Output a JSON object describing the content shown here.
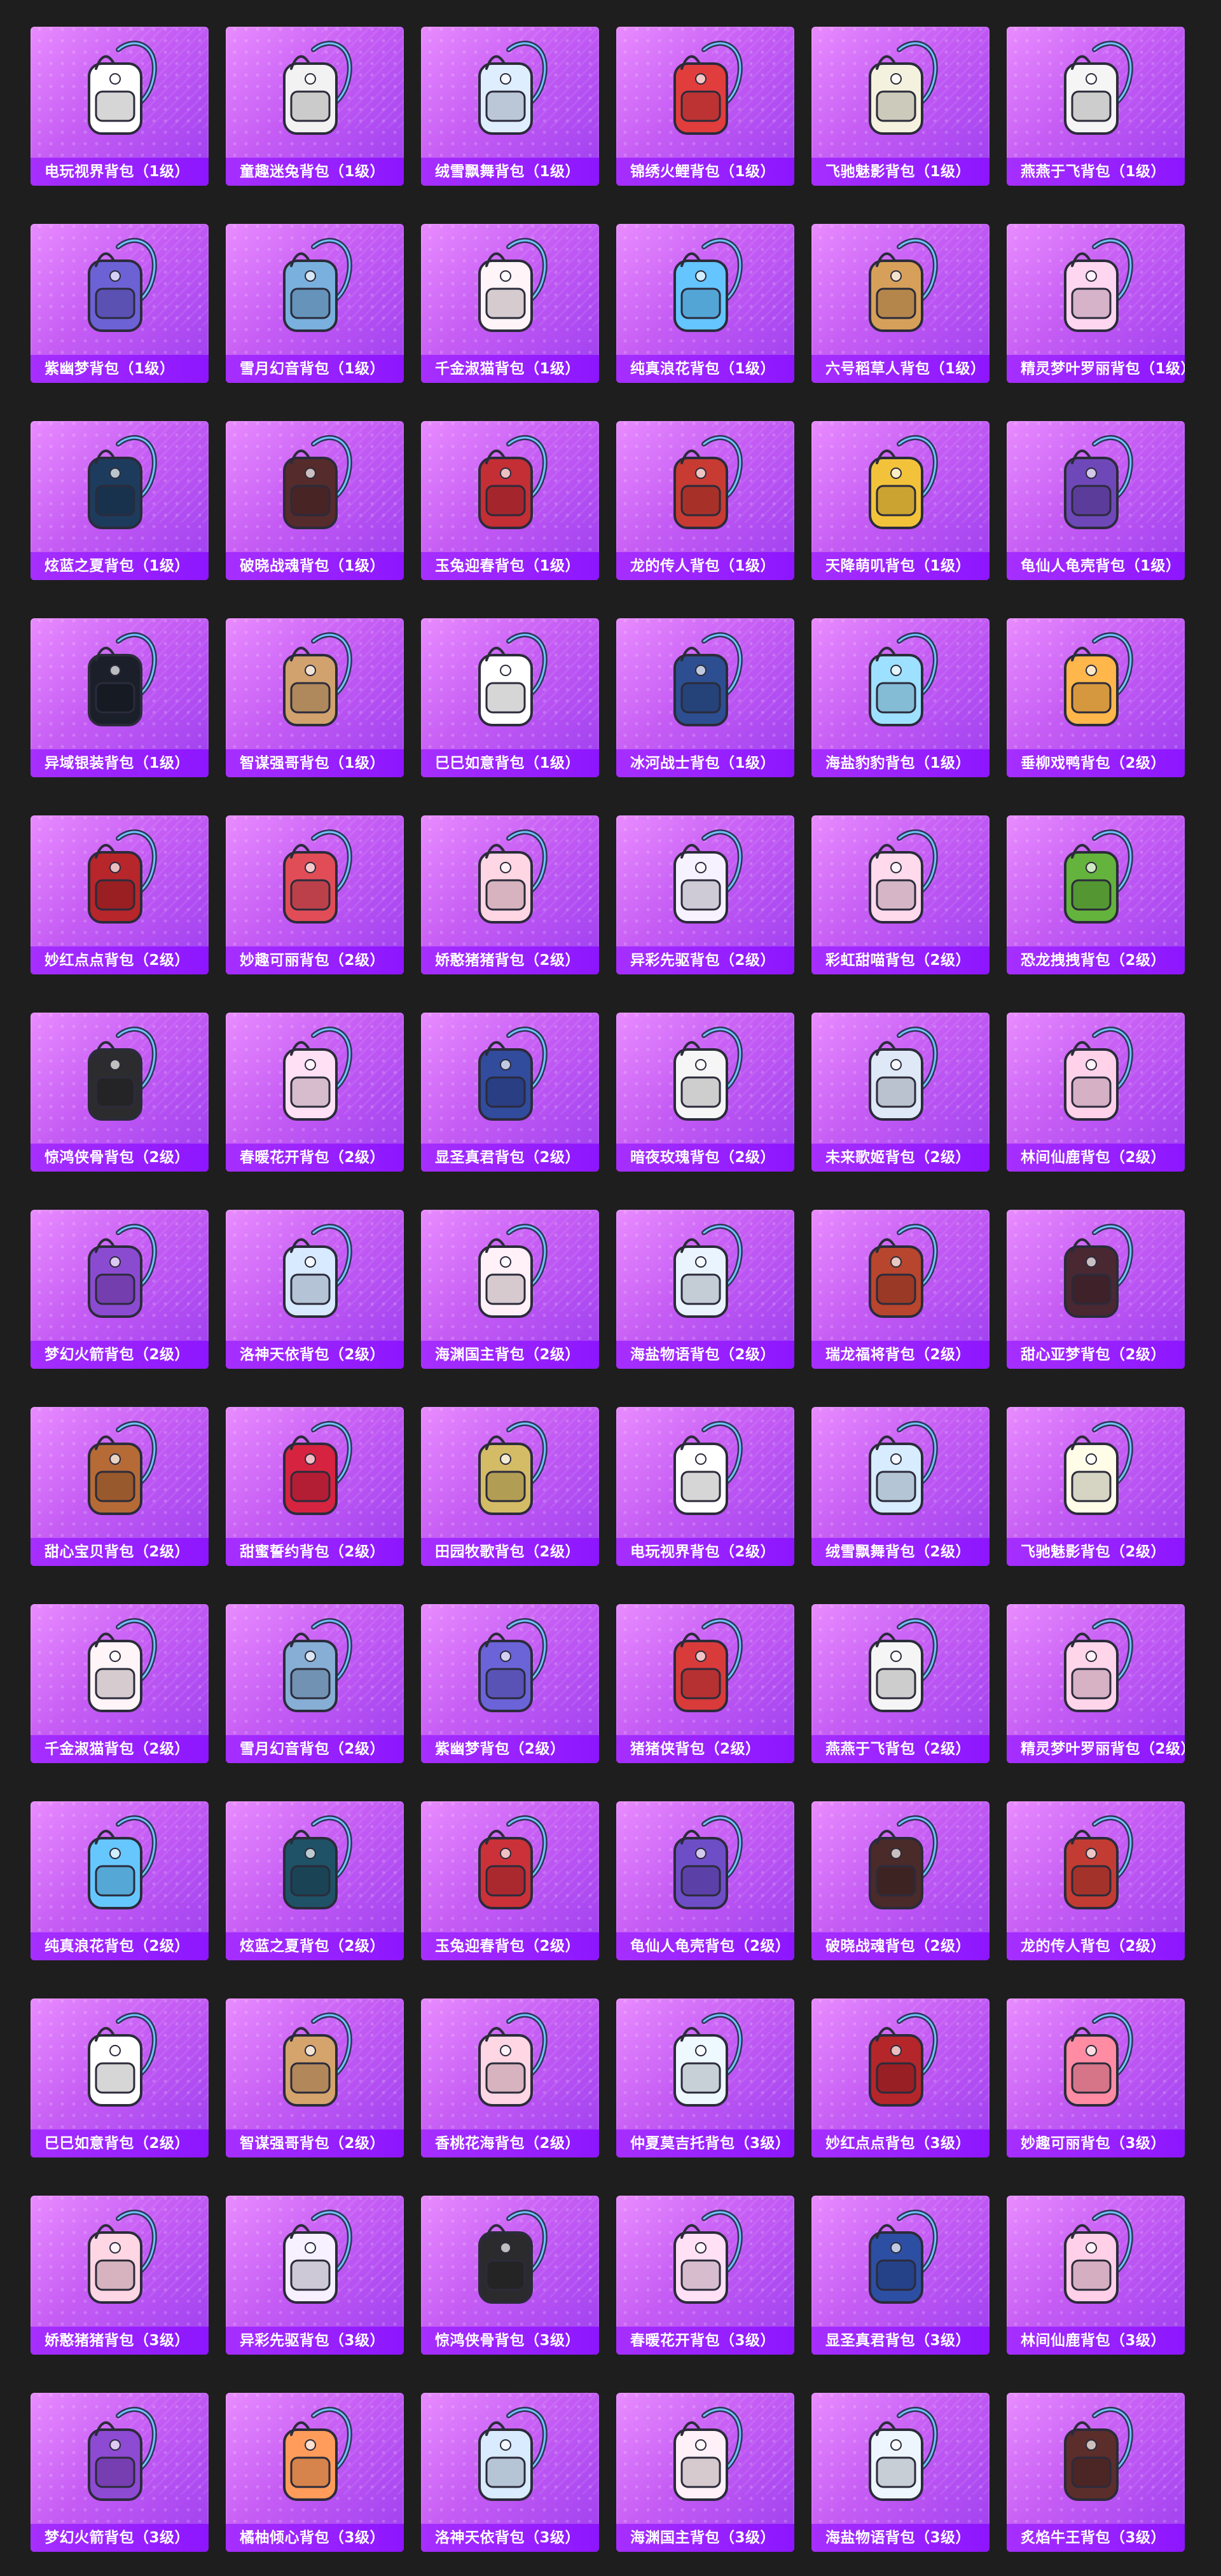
{
  "items": [
    {
      "label": "电玩视界背包（1级）",
      "icon": "backpack-icon",
      "color": "#ffffff"
    },
    {
      "label": "童趣迷兔背包（1级）",
      "icon": "backpack-icon",
      "color": "#f2f2f2"
    },
    {
      "label": "绒雪飘舞背包（1级）",
      "icon": "backpack-icon",
      "color": "#dfeeff"
    },
    {
      "label": "锦绣火鲤背包（1级）",
      "icon": "backpack-icon",
      "color": "#e23d3d"
    },
    {
      "label": "飞驰魅影背包（1级）",
      "icon": "backpack-icon",
      "color": "#f4f1de"
    },
    {
      "label": "燕燕于飞背包（1级）",
      "icon": "backpack-icon",
      "color": "#f5f5f5"
    },
    {
      "label": "紫幽梦背包（1级）",
      "icon": "backpack-icon",
      "color": "#6d61d6"
    },
    {
      "label": "雪月幻音背包（1级）",
      "icon": "backpack-icon",
      "color": "#79b0dd"
    },
    {
      "label": "千金淑猫背包（1级）",
      "icon": "backpack-icon",
      "color": "#fff4f7"
    },
    {
      "label": "纯真浪花背包（1级）",
      "icon": "backpack-icon",
      "color": "#64c5ff"
    },
    {
      "label": "六号稻草人背包（1级）",
      "icon": "backpack-icon",
      "color": "#d7a05a"
    },
    {
      "label": "精灵梦叶罗丽背包（1级）",
      "icon": "backpack-icon",
      "color": "#ffd6ef"
    },
    {
      "label": "炫蓝之夏背包（1级）",
      "icon": "backpack-icon",
      "color": "#1d3c5d"
    },
    {
      "label": "破晓战魂背包（1级）",
      "icon": "backpack-icon",
      "color": "#562b2b"
    },
    {
      "label": "玉兔迎春背包（1级）",
      "icon": "backpack-icon",
      "color": "#c42e35"
    },
    {
      "label": "龙的传人背包（1级）",
      "icon": "backpack-icon",
      "color": "#c73b32"
    },
    {
      "label": "天降萌叽背包（1级）",
      "icon": "backpack-icon",
      "color": "#f2c33a"
    },
    {
      "label": "龟仙人龟壳背包（1级）",
      "icon": "backpack-icon",
      "color": "#6e48b9"
    },
    {
      "label": "异域银装背包（1级）",
      "icon": "backpack-icon",
      "color": "#1b1f2a"
    },
    {
      "label": "智谋强哥背包（1级）",
      "icon": "backpack-icon",
      "color": "#d1a26d"
    },
    {
      "label": "巳巳如意背包（1级）",
      "icon": "backpack-icon",
      "color": "#ffffff"
    },
    {
      "label": "冰河战士背包（1级）",
      "icon": "backpack-icon",
      "color": "#2d4f91"
    },
    {
      "label": "海盐豹豹背包（1级）",
      "icon": "backpack-icon",
      "color": "#9ee0ff"
    },
    {
      "label": "垂柳戏鸭背包（2级）",
      "icon": "backpack-icon",
      "color": "#ffb64a"
    },
    {
      "label": "妙红点点背包（2级）",
      "icon": "backpack-icon",
      "color": "#b7262a"
    },
    {
      "label": "妙趣可丽背包（2级）",
      "icon": "backpack-icon",
      "color": "#e14d57"
    },
    {
      "label": "娇憨猪猪背包（2级）",
      "icon": "backpack-icon",
      "color": "#ffd6e3"
    },
    {
      "label": "异彩先驱背包（2级）",
      "icon": "backpack-icon",
      "color": "#f7f2ff"
    },
    {
      "label": "彩虹甜喵背包（2级）",
      "icon": "backpack-icon",
      "color": "#ffd9ec"
    },
    {
      "label": "恐龙拽拽背包（2级）",
      "icon": "backpack-icon",
      "color": "#64b33c"
    },
    {
      "label": "惊鸿侠骨背包（2级）",
      "icon": "backpack-icon",
      "color": "#2c2c2e"
    },
    {
      "label": "春暖花开背包（2级）",
      "icon": "backpack-icon",
      "color": "#ffe0f4"
    },
    {
      "label": "显圣真君背包（2级）",
      "icon": "backpack-icon",
      "color": "#314b9d"
    },
    {
      "label": "暗夜玫瑰背包（2级）",
      "icon": "backpack-icon",
      "color": "#f6f6f6"
    },
    {
      "label": "未来歌姬背包（2级）",
      "icon": "backpack-icon",
      "color": "#dfe8f7"
    },
    {
      "label": "林间仙鹿背包（2级）",
      "icon": "backpack-icon",
      "color": "#ffd2ea"
    },
    {
      "label": "梦幻火箭背包（2级）",
      "icon": "backpack-icon",
      "color": "#8b4bd1"
    },
    {
      "label": "洛神天依背包（2级）",
      "icon": "backpack-icon",
      "color": "#d7eaff"
    },
    {
      "label": "海渊国主背包（2级）",
      "icon": "backpack-icon",
      "color": "#fff1f7"
    },
    {
      "label": "海盐物语背包（2级）",
      "icon": "backpack-icon",
      "color": "#eaf4ff"
    },
    {
      "label": "瑞龙福将背包（2级）",
      "icon": "backpack-icon",
      "color": "#b8452d"
    },
    {
      "label": "甜心亚梦背包（2级）",
      "icon": "backpack-icon",
      "color": "#4a2832"
    },
    {
      "label": "甜心宝贝背包（2级）",
      "icon": "backpack-icon",
      "color": "#b66b36"
    },
    {
      "label": "甜蜜誓约背包（2级）",
      "icon": "backpack-icon",
      "color": "#d62440"
    },
    {
      "label": "田园牧歌背包（2级）",
      "icon": "backpack-icon",
      "color": "#d4bb66"
    },
    {
      "label": "电玩视界背包（2级）",
      "icon": "backpack-icon",
      "color": "#ffffff"
    },
    {
      "label": "绒雪飘舞背包（2级）",
      "icon": "backpack-icon",
      "color": "#d7ecff"
    },
    {
      "label": "飞驰魅影背包（2级）",
      "icon": "backpack-icon",
      "color": "#fffde8"
    },
    {
      "label": "千金淑猫背包（2级）",
      "icon": "backpack-icon",
      "color": "#fff4f7"
    },
    {
      "label": "雪月幻音背包（2级）",
      "icon": "backpack-icon",
      "color": "#87aed4"
    },
    {
      "label": "紫幽梦背包（2级）",
      "icon": "backpack-icon",
      "color": "#6b63d8"
    },
    {
      "label": "猪猪侠背包（2级）",
      "icon": "backpack-icon",
      "color": "#d93b3b"
    },
    {
      "label": "燕燕于飞背包（2级）",
      "icon": "backpack-icon",
      "color": "#f5f5f5"
    },
    {
      "label": "精灵梦叶罗丽背包（2级）",
      "icon": "backpack-icon",
      "color": "#ffd5ea"
    },
    {
      "label": "纯真浪花背包（2级）",
      "icon": "backpack-icon",
      "color": "#66c7ff"
    },
    {
      "label": "炫蓝之夏背包（2级）",
      "icon": "backpack-icon",
      "color": "#1f5267"
    },
    {
      "label": "玉兔迎春背包（2级）",
      "icon": "backpack-icon",
      "color": "#cb3138"
    },
    {
      "label": "龟仙人龟壳背包（2级）",
      "icon": "backpack-icon",
      "color": "#6d4ec7"
    },
    {
      "label": "破晓战魂背包（2级）",
      "icon": "backpack-icon",
      "color": "#4b2a2a"
    },
    {
      "label": "龙的传人背包（2级）",
      "icon": "backpack-icon",
      "color": "#c33c33"
    },
    {
      "label": "巳巳如意背包（2级）",
      "icon": "backpack-icon",
      "color": "#ffffff"
    },
    {
      "label": "智谋强哥背包（2级）",
      "icon": "backpack-icon",
      "color": "#d5a36c"
    },
    {
      "label": "香桃花海背包（2级）",
      "icon": "backpack-icon",
      "color": "#ffd6e3"
    },
    {
      "label": "仲夏莫吉托背包（3级）",
      "icon": "backpack-icon",
      "color": "#eef8ff"
    },
    {
      "label": "妙红点点背包（3级）",
      "icon": "backpack-icon",
      "color": "#b5262a"
    },
    {
      "label": "妙趣可丽背包（3级）",
      "icon": "backpack-icon",
      "color": "#ff8ca2"
    },
    {
      "label": "娇憨猪猪背包（3级）",
      "icon": "backpack-icon",
      "color": "#ffd6e3"
    },
    {
      "label": "异彩先驱背包（3级）",
      "icon": "backpack-icon",
      "color": "#f6f0ff"
    },
    {
      "label": "惊鸿侠骨背包（3级）",
      "icon": "backpack-icon",
      "color": "#2b2b2d"
    },
    {
      "label": "春暖花开背包（3级）",
      "icon": "backpack-icon",
      "color": "#ffe0f5"
    },
    {
      "label": "显圣真君背包（3级）",
      "icon": "backpack-icon",
      "color": "#2d4fa3"
    },
    {
      "label": "林间仙鹿背包（3级）",
      "icon": "backpack-icon",
      "color": "#ffd0e8"
    },
    {
      "label": "梦幻火箭背包（3级）",
      "icon": "backpack-icon",
      "color": "#8d4ad2"
    },
    {
      "label": "橘柚倾心背包（3级）",
      "icon": "backpack-icon",
      "color": "#ff9c5b"
    },
    {
      "label": "洛神天依背包（3级）",
      "icon": "backpack-icon",
      "color": "#d8ebff"
    },
    {
      "label": "海渊国主背包（3级）",
      "icon": "backpack-icon",
      "color": "#fff1f7"
    },
    {
      "label": "海盐物语背包（3级）",
      "icon": "backpack-icon",
      "color": "#edf6ff"
    },
    {
      "label": "炙焰牛王背包（3级）",
      "icon": "backpack-icon",
      "color": "#5b2e2b"
    }
  ]
}
